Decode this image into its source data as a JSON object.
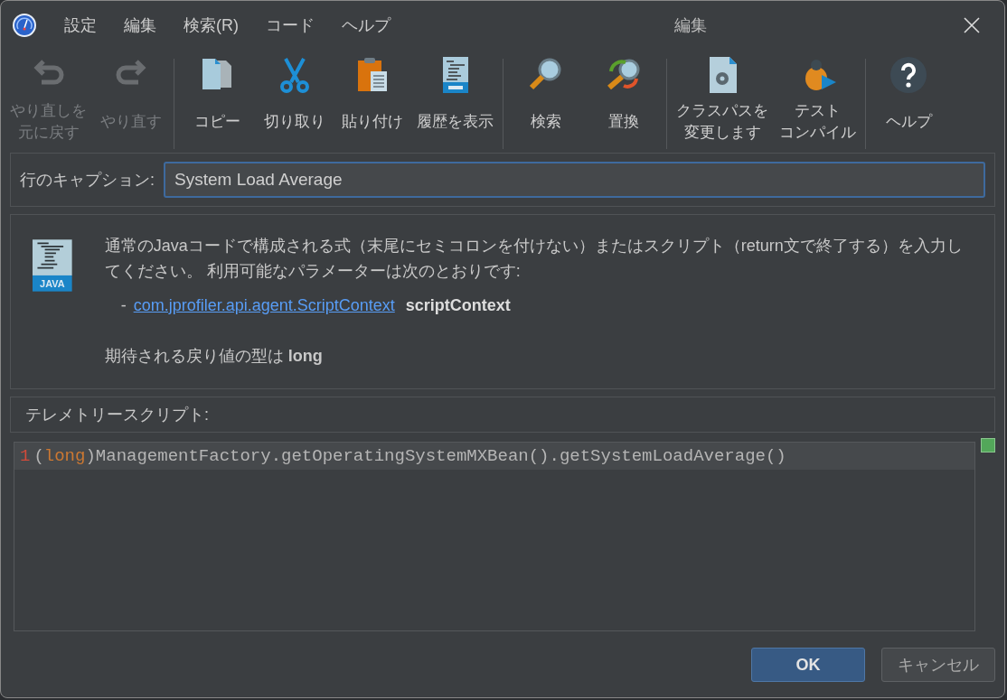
{
  "window": {
    "title": "編集"
  },
  "menu": [
    "設定",
    "編集",
    "検索(R)",
    "コード",
    "ヘルプ"
  ],
  "toolbar": {
    "groups": [
      [
        {
          "label": [
            "やり直しを",
            "元に戻す"
          ],
          "disabled": true
        },
        {
          "label": [
            "やり直す"
          ],
          "disabled": true
        }
      ],
      [
        {
          "label": [
            "コピー"
          ],
          "disabled": false
        },
        {
          "label": [
            "切り取り"
          ],
          "disabled": false
        },
        {
          "label": [
            "貼り付け"
          ],
          "disabled": false
        },
        {
          "label": [
            "履歴を表示"
          ],
          "disabled": false
        }
      ],
      [
        {
          "label": [
            "検索"
          ],
          "disabled": false
        },
        {
          "label": [
            "置換"
          ],
          "disabled": false
        }
      ],
      [
        {
          "label": [
            "クラスパスを",
            "変更します"
          ],
          "disabled": false
        },
        {
          "label": [
            "テスト",
            "コンパイル"
          ],
          "disabled": false
        }
      ],
      [
        {
          "label": [
            "ヘルプ"
          ],
          "disabled": false
        }
      ]
    ]
  },
  "caption": {
    "label": "行のキャプション:",
    "value": "System Load Average"
  },
  "info": {
    "icon_label": "JAVA",
    "description": "通常のJavaコードで構成される式（末尾にセミコロンを付けない）またはスクリプト（return文で終了する）を入力してください。 利用可能なパラメーターは次のとおりです:",
    "parameter": {
      "dash": "-",
      "type": "com.jprofiler.api.agent.ScriptContext",
      "name": "scriptContext"
    },
    "expected": "期待される戻り値の型は **long**"
  },
  "script": {
    "label": "テレメトリースクリプト:",
    "lines": [
      {
        "number": "1",
        "tokens": [
          {
            "text": "(",
            "kind": "plain"
          },
          {
            "text": "long",
            "kind": "keyword"
          },
          {
            "text": ")ManagementFactory.getOperatingSystemMXBean().getSystemLoadAverage()",
            "kind": "plain"
          }
        ]
      }
    ]
  },
  "buttons": [
    {
      "label": "OK",
      "default": true
    },
    {
      "label": "キャンセル",
      "default": false
    }
  ]
}
